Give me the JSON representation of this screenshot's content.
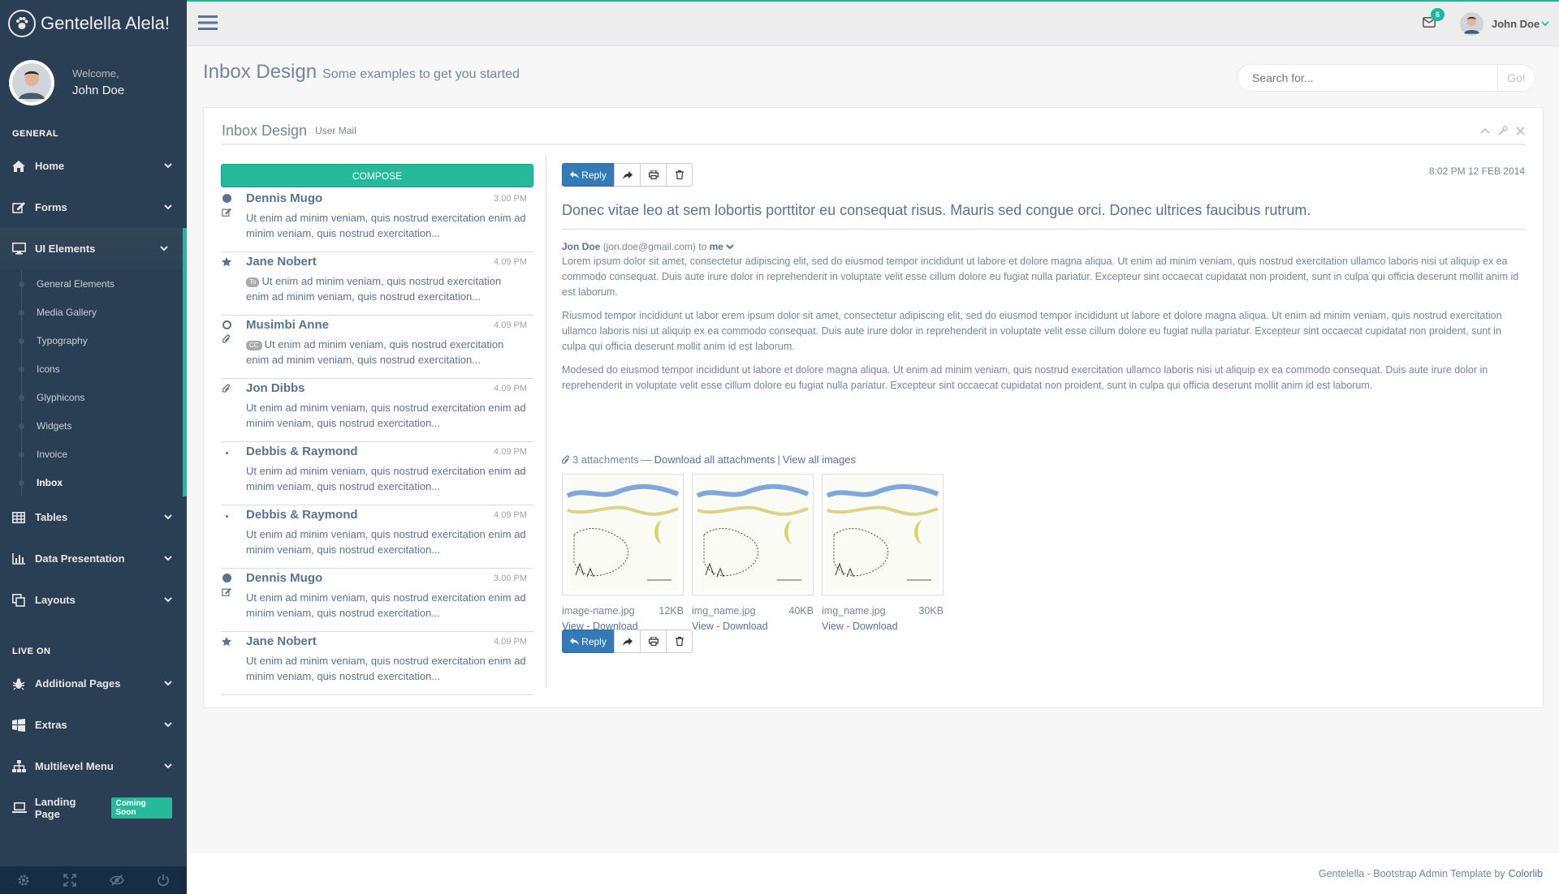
{
  "app": {
    "brand": "Gentelella Alela!"
  },
  "colors": {
    "sidebar_bg": "#2a3f54",
    "accent": "#1abb9c",
    "primary": "#337ab7",
    "text": "#73879c"
  },
  "sidebar": {
    "welcome": "Welcome,",
    "user_name": "John Doe",
    "section_general": "GENERAL",
    "section_live": "LIVE ON",
    "general_items": [
      {
        "label": "Home",
        "icon": "home-icon"
      },
      {
        "label": "Forms",
        "icon": "edit-icon"
      },
      {
        "label": "UI Elements",
        "icon": "desktop-icon"
      }
    ],
    "ui_sub": [
      "General Elements",
      "Media Gallery",
      "Typography",
      "Icons",
      "Glyphicons",
      "Widgets",
      "Invoice",
      "Inbox"
    ],
    "general_items_after": [
      {
        "label": "Tables",
        "icon": "table-icon"
      },
      {
        "label": "Data Presentation",
        "icon": "bar-chart-icon"
      },
      {
        "label": "Layouts",
        "icon": "clone-icon"
      }
    ],
    "live_items": [
      {
        "label": "Additional Pages",
        "icon": "bug-icon"
      },
      {
        "label": "Extras",
        "icon": "windows-icon"
      },
      {
        "label": "Multilevel Menu",
        "icon": "sitemap-icon"
      },
      {
        "label": "Landing Page",
        "icon": "laptop-icon"
      }
    ],
    "landing_badge": "Coming Soon"
  },
  "topnav": {
    "mail_count": "6",
    "user_name": "John Doe"
  },
  "page": {
    "title": "Inbox Design",
    "subtitle": "Some examples to get you started"
  },
  "search": {
    "placeholder": "Search for...",
    "go_label": "Go!"
  },
  "panel": {
    "title": "Inbox Design",
    "subtitle": "User Mail"
  },
  "compose_label": "COMPOSE",
  "mails": [
    {
      "from": "Dennis Mugo",
      "time": "3.00 PM",
      "tag": "",
      "snippet": "Ut enim ad minim veniam, quis nostrud exercitation enim ad minim veniam, quis nostrud exercitation..."
    },
    {
      "from": "Jane Nobert",
      "time": "4.09 PM",
      "tag": "To",
      "snippet": "Ut enim ad minim veniam, quis nostrud exercitation enim ad minim veniam, quis nostrud exercitation..."
    },
    {
      "from": "Musimbi Anne",
      "time": "4.09 PM",
      "tag": "CC",
      "snippet": "Ut enim ad minim veniam, quis nostrud exercitation enim ad minim veniam, quis nostrud exercitation..."
    },
    {
      "from": "Jon Dibbs",
      "time": "4.09 PM",
      "tag": "",
      "snippet": "Ut enim ad minim veniam, quis nostrud exercitation enim ad minim veniam, quis nostrud exercitation..."
    },
    {
      "from": "Debbis & Raymond",
      "time": "4.09 PM",
      "tag": "",
      "snippet": "Ut enim ad minim veniam, quis nostrud exercitation enim ad minim veniam, quis nostrud exercitation..."
    },
    {
      "from": "Debbis & Raymond",
      "time": "4.09 PM",
      "tag": "",
      "snippet": "Ut enim ad minim veniam, quis nostrud exercitation enim ad minim veniam, quis nostrud exercitation..."
    },
    {
      "from": "Dennis Mugo",
      "time": "3.00 PM",
      "tag": "",
      "snippet": "Ut enim ad minim veniam, quis nostrud exercitation enim ad minim veniam, quis nostrud exercitation..."
    },
    {
      "from": "Jane Nobert",
      "time": "4.09 PM",
      "tag": "",
      "snippet": "Ut enim ad minim veniam, quis nostrud exercitation enim ad minim veniam, quis nostrud exercitation..."
    }
  ],
  "view": {
    "reply_label": "Reply",
    "date": "8:02 PM 12 FEB 2014",
    "subject": "Donec vitae leo at sem lobortis porttitor eu consequat risus. Mauris sed congue orci. Donec ultrices faucibus rutrum.",
    "sender_name": "Jon Doe",
    "sender_email": "(jon.doe@gmail.com) to",
    "recipient": "me",
    "paragraphs": [
      "Lorem ipsum dolor sit amet, consectetur adipiscing elit, sed do eiusmod tempor incididunt ut labore et dolore magna aliqua. Ut enim ad minim veniam, quis nostrud exercitation ullamco laboris nisi ut aliquip ex ea commodo consequat. Duis aute irure dolor in reprehenderit in voluptate velit esse cillum dolore eu fugiat nulla pariatur. Excepteur sint occaecat cupidatat non proident, sunt in culpa qui officia deserunt mollit anim id est laborum.",
      "Riusmod tempor incididunt ut labor erem ipsum dolor sit amet, consectetur adipiscing elit, sed do eiusmod tempor incididunt ut labore et dolore magna aliqua. Ut enim ad minim veniam, quis nostrud exercitation ullamco laboris nisi ut aliquip ex ea commodo consequat. Duis aute irure dolor in reprehenderit in voluptate velit esse cillum dolore eu fugiat nulla pariatur. Excepteur sint occaecat cupidatat non proident, sunt in culpa qui officia deserunt mollit anim id est laborum.",
      "Modesed do eiusmod tempor incididunt ut labore et dolore magna aliqua. Ut enim ad minim veniam, quis nostrud exercitation ullamco laboris nisi ut aliquip ex ea commodo consequat. Duis aute irure dolor in reprehenderit in voluptate velit esse cillum dolore eu fugiat nulla pariatur. Excepteur sint occaecat cupidatat non proident, sunt in culpa qui officia deserunt mollit anim id est laborum."
    ],
    "attachments_count": "3 attachments",
    "dash": "—",
    "download_all": "Download all attachments",
    "sep": "|",
    "view_all": "View all images",
    "files": [
      {
        "name": "image-name.jpg",
        "size": "12KB",
        "links": "View - Download"
      },
      {
        "name": "img_name.jpg",
        "size": "40KB",
        "links": "View - Download"
      },
      {
        "name": "img_name.jpg",
        "size": "30KB",
        "links": "View - Download"
      }
    ]
  },
  "footer": {
    "text": "Gentelella - Bootstrap Admin Template by",
    "link": "Colorlib"
  }
}
